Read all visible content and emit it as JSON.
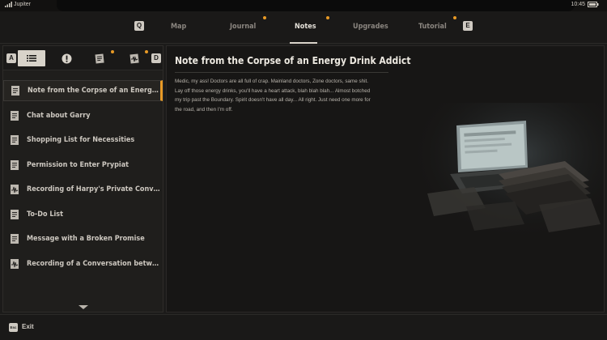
{
  "status": {
    "carrier": "Jupiter",
    "time": "10:45"
  },
  "nav": {
    "left_key": "Q",
    "right_key": "E",
    "tabs": [
      {
        "label": "Map",
        "active": false,
        "has_dot": false
      },
      {
        "label": "Journal",
        "active": false,
        "has_dot": true
      },
      {
        "label": "Notes",
        "active": true,
        "has_dot": true
      },
      {
        "label": "Upgrades",
        "active": false,
        "has_dot": false
      },
      {
        "label": "Tutorial",
        "active": false,
        "has_dot": true
      }
    ]
  },
  "filters": {
    "left_key": "A",
    "right_key": "D",
    "buttons": [
      {
        "icon": "list-icon",
        "active": true
      },
      {
        "icon": "exclamation-icon",
        "active": false
      },
      {
        "icon": "note-icon",
        "active": false,
        "has_dot": true
      },
      {
        "icon": "audio-note-icon",
        "active": false,
        "has_dot": true
      }
    ]
  },
  "notes_list": [
    {
      "label": "Note from the Corpse of an Energy Drink A...",
      "icon": "note-icon",
      "selected": true
    },
    {
      "label": "Chat about Garry",
      "icon": "note-icon",
      "selected": false
    },
    {
      "label": "Shopping List for Necessities",
      "icon": "note-icon",
      "selected": false
    },
    {
      "label": "Permission to Enter Prypiat",
      "icon": "note-icon",
      "selected": false
    },
    {
      "label": "Recording of Harpy's Private Conversation...",
      "icon": "audio-note-icon",
      "selected": false
    },
    {
      "label": "To-Do List",
      "icon": "note-icon",
      "selected": false
    },
    {
      "label": "Message with a Broken Promise",
      "icon": "note-icon",
      "selected": false
    },
    {
      "label": "Recording of a Conversation between Faust...",
      "icon": "audio-note-icon",
      "selected": false
    }
  ],
  "note": {
    "title": "Note from the Corpse of an Energy Drink Addict",
    "body": "Medic, my ass! Doctors are all full of crap. Mainland doctors, Zone doctors, same shit. Lay off those energy drinks, you'll have a heart attack, blah blah blah... Almost botched my trip past the Boundary. Spirit doesn't have all day... All right. Just need one more for the road, and then I'm off."
  },
  "footer": {
    "key": "Esc",
    "exit_label": "Exit"
  },
  "colors": {
    "accent": "#e89a26",
    "background": "#1c1b1a",
    "text": "#d8d4cc"
  }
}
